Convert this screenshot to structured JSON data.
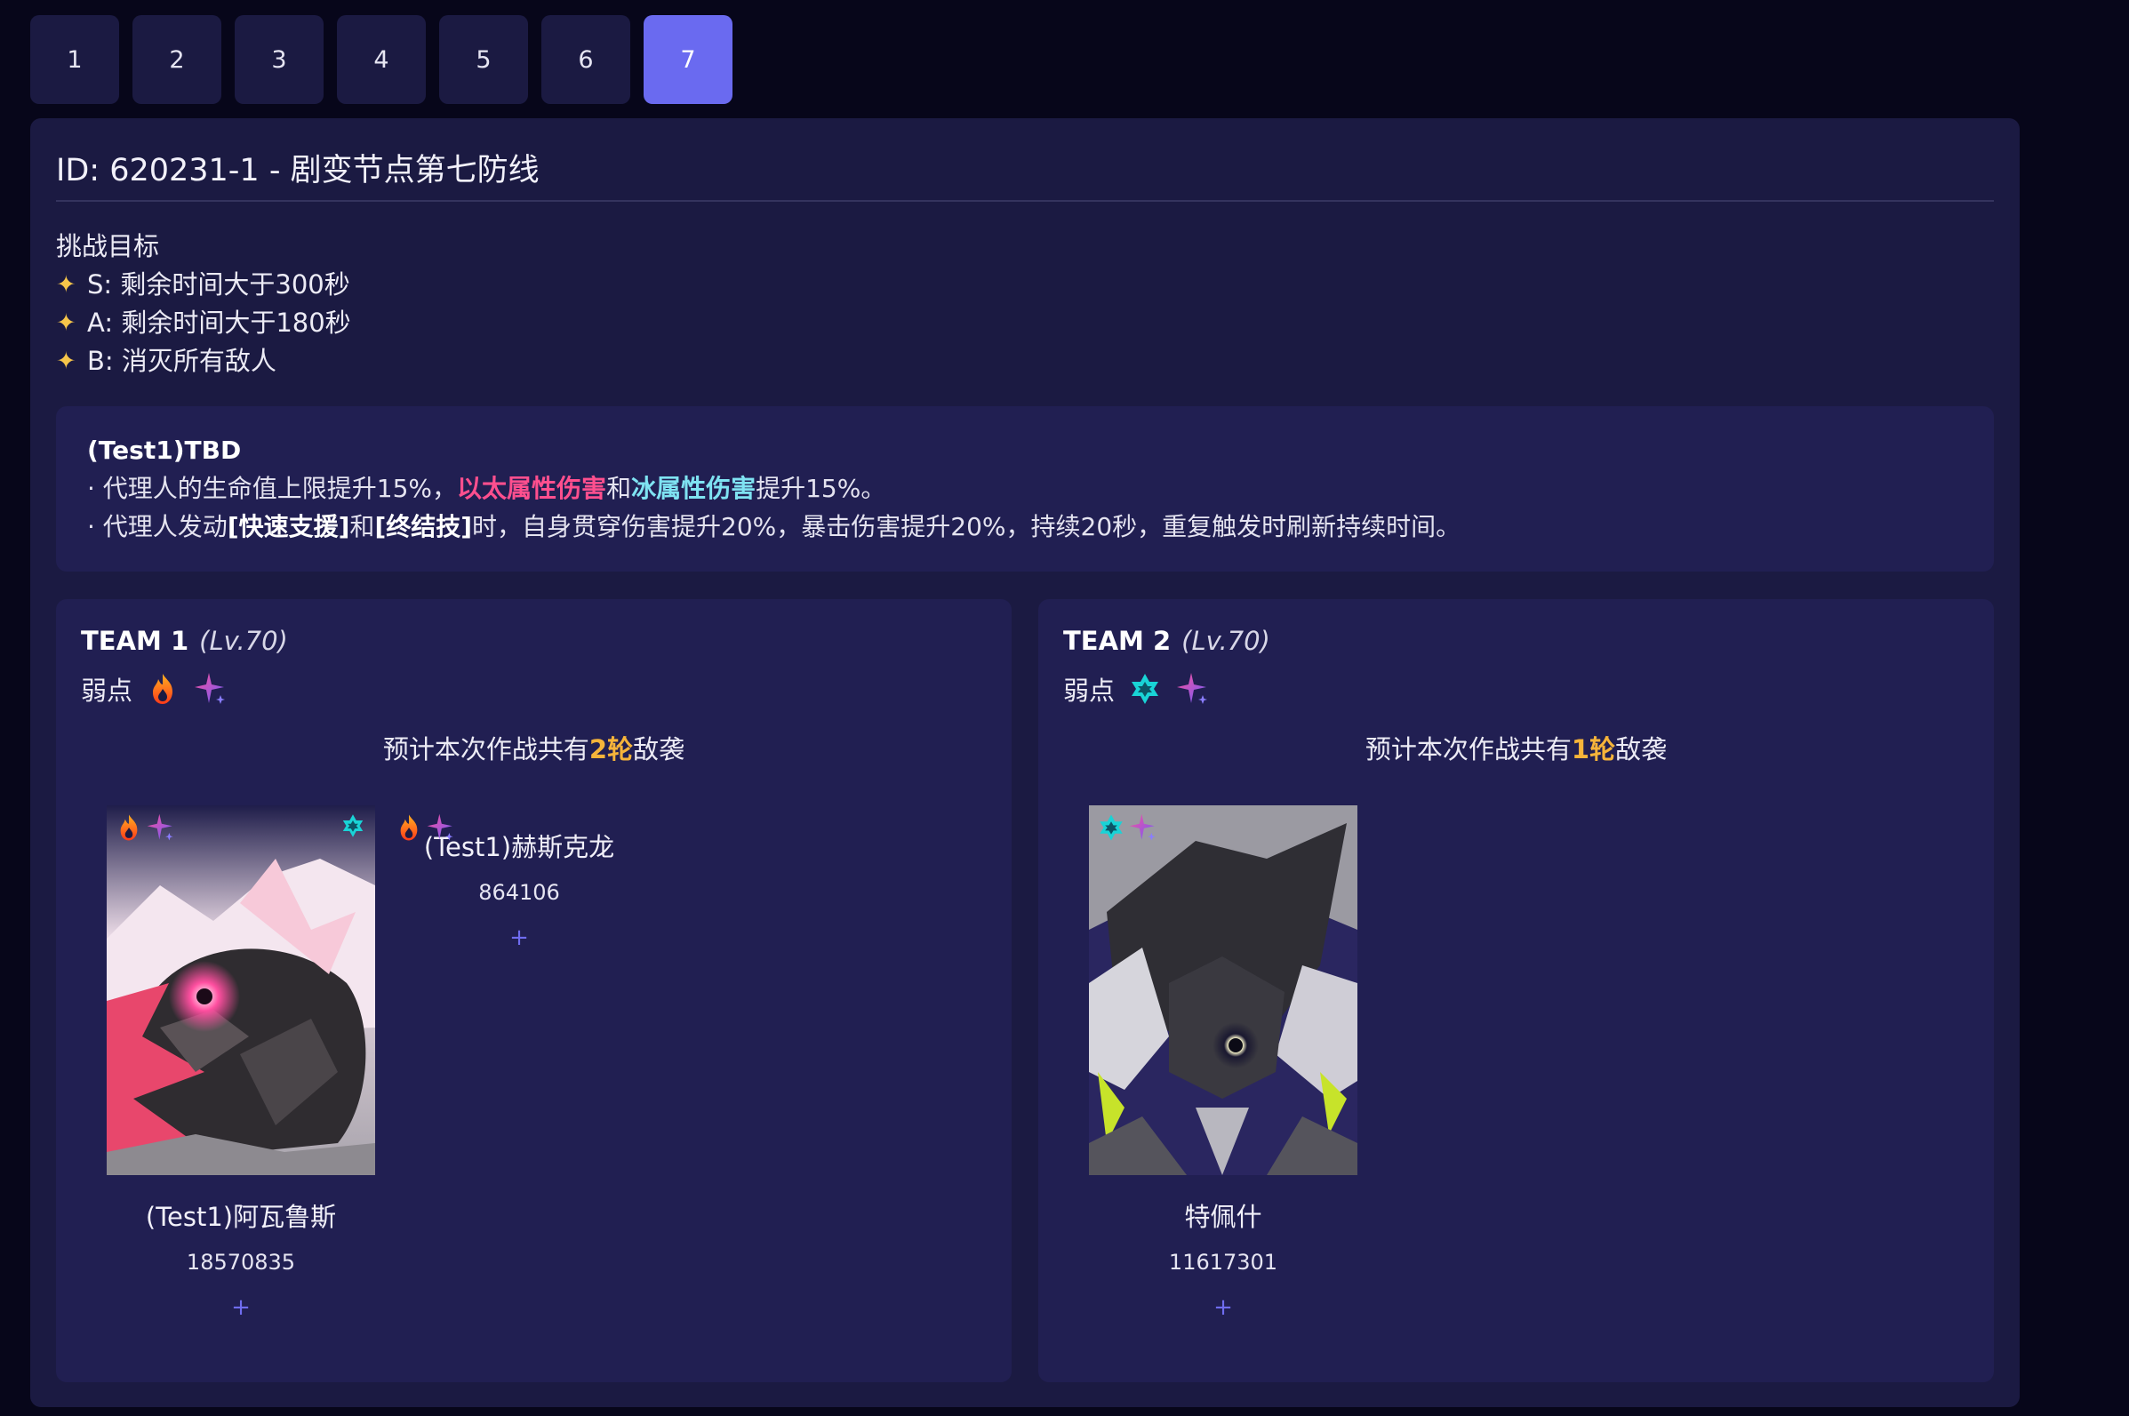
{
  "tabs": [
    {
      "label": "1",
      "active": false
    },
    {
      "label": "2",
      "active": false
    },
    {
      "label": "3",
      "active": false
    },
    {
      "label": "4",
      "active": false
    },
    {
      "label": "5",
      "active": false
    },
    {
      "label": "6",
      "active": false
    },
    {
      "label": "7",
      "active": true
    }
  ],
  "colors": {
    "background": "#07061a",
    "panel": "#1b1a42",
    "card": "#211f52",
    "accent": "#6a6af0",
    "gold": "#f6b43a",
    "pink": "#ff4f8e",
    "cyan": "#7fe3f2"
  },
  "stage": {
    "title": "ID: 620231-1 - 剧变节点第七防线"
  },
  "goals": {
    "heading": "挑战目标",
    "items": [
      {
        "star": "✦",
        "text": "S: 剩余时间大于300秒"
      },
      {
        "star": "✦",
        "text": "A: 剩余时间大于180秒"
      },
      {
        "star": "✦",
        "text": "B: 消灭所有敌人"
      }
    ]
  },
  "buff": {
    "title": "(Test1)TBD",
    "line1": {
      "prefix": "· 代理人的生命值上限提升15%，",
      "hl1": "以太属性伤害",
      "mid": "和",
      "hl2": "冰属性伤害",
      "suffix": "提升15%。"
    },
    "line2": {
      "prefix": "· 代理人发动",
      "hl1": "[快速支援]",
      "mid": "和",
      "hl2": "[终结技]",
      "suffix": "时，自身贯穿伤害提升20%，暴击伤害提升20%，持续20秒，重复触发时刷新持续时间。"
    }
  },
  "teams": [
    {
      "name": "TEAM 1",
      "level": "(Lv.70)",
      "weak_label": "弱点",
      "weak_icons": [
        "fire-icon",
        "ether-icon"
      ],
      "waves_prefix": "预计本次作战共有",
      "waves_count": "2轮",
      "waves_suffix": "敌袭",
      "enemies": [
        {
          "name": "(Test1)阿瓦鲁斯",
          "hp": "18570835",
          "plus": "+"
        },
        {
          "name": "(Test1)赫斯克龙",
          "hp": "864106",
          "plus": "+"
        }
      ]
    },
    {
      "name": "TEAM 2",
      "level": "(Lv.70)",
      "weak_label": "弱点",
      "weak_icons": [
        "ice-icon",
        "ether-icon"
      ],
      "waves_prefix": "预计本次作战共有",
      "waves_count": "1轮",
      "waves_suffix": "敌袭",
      "enemies": [
        {
          "name": "特佩什",
          "hp": "11617301",
          "plus": "+"
        }
      ]
    }
  ]
}
